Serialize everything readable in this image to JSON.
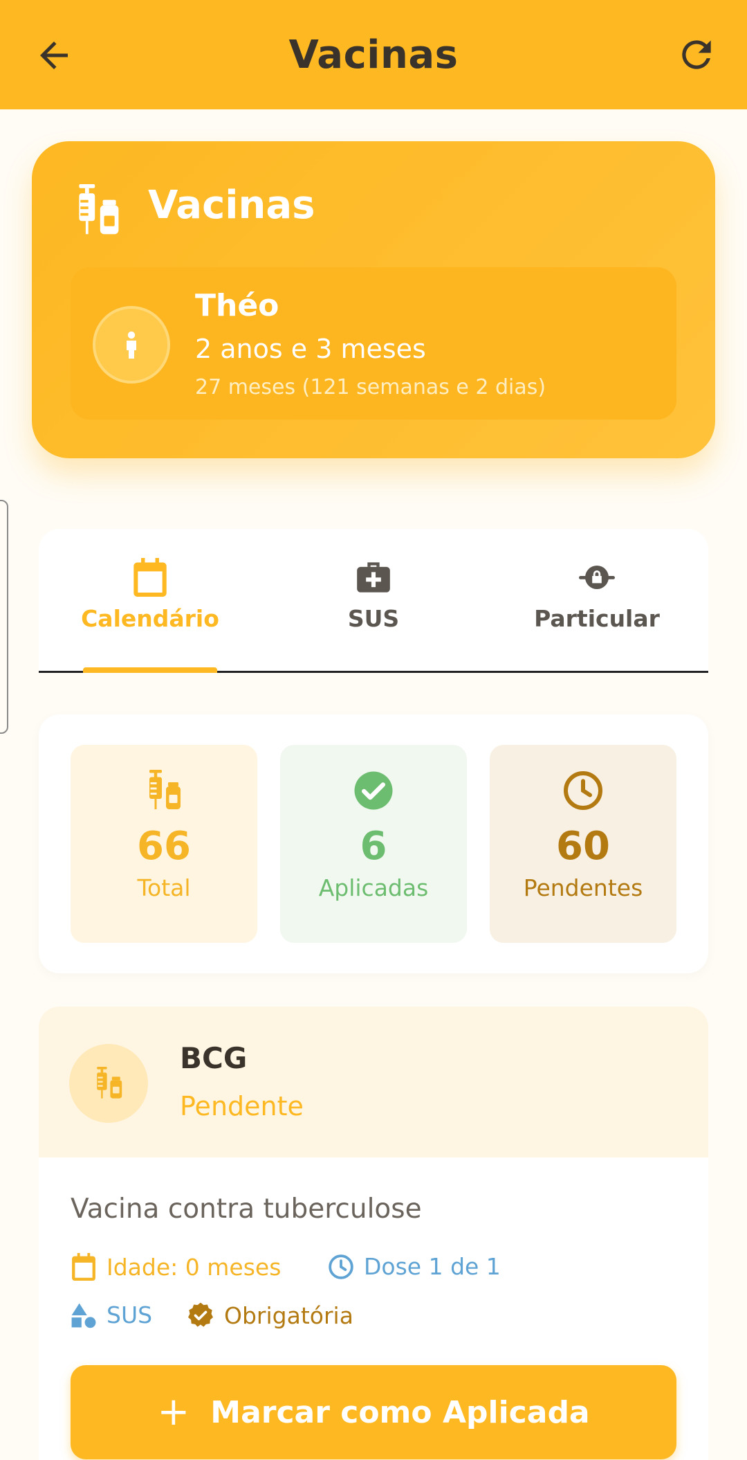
{
  "appbar": {
    "title": "Vacinas"
  },
  "hero": {
    "title": "Vacinas",
    "child": {
      "name": "Théo",
      "age": "2 anos e 3 meses",
      "age_detail": "27 meses (121 semanas e 2 dias)"
    }
  },
  "tabs": [
    {
      "label": "Calendário",
      "icon": "calendar-icon",
      "active": true
    },
    {
      "label": "SUS",
      "icon": "medical-kit-icon",
      "active": false
    },
    {
      "label": "Particular",
      "icon": "private-lock-icon",
      "active": false
    }
  ],
  "stats": {
    "total": {
      "value": "66",
      "label": "Total"
    },
    "applied": {
      "value": "6",
      "label": "Aplicadas"
    },
    "pending": {
      "value": "60",
      "label": "Pendentes"
    }
  },
  "vaccine": {
    "name": "BCG",
    "status": "Pendente",
    "description": "Vacina contra tuberculose",
    "age": "Idade: 0 meses",
    "dose": "Dose 1 de 1",
    "network": "SUS",
    "requirement": "Obrigatória",
    "action_label": "Marcar como Aplicada"
  },
  "colors": {
    "primary": "#fdb822",
    "applied": "#6dbd70",
    "pending": "#b47a12",
    "info": "#5ea3d4",
    "text": "#3a332b"
  }
}
